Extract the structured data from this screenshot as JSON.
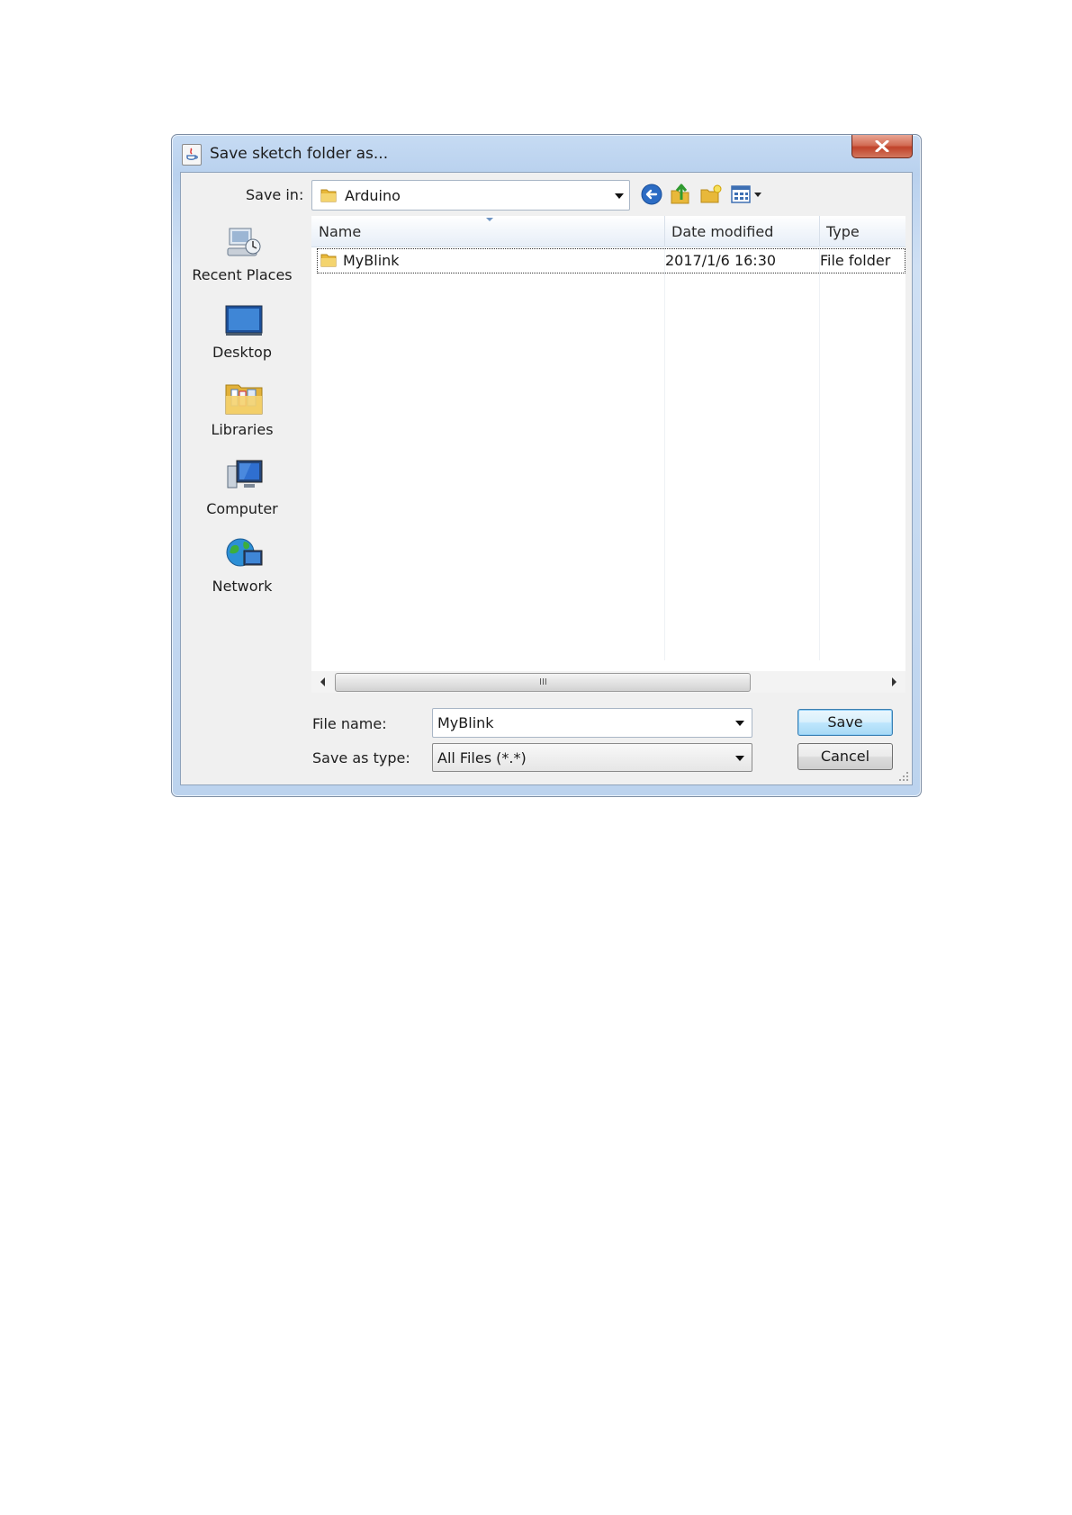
{
  "dialog": {
    "title": "Save sketch folder as...",
    "close_icon": "close-icon"
  },
  "toolbar": {
    "save_in_label": "Save in:",
    "save_in_value": "Arduino",
    "icons": [
      "back-icon",
      "up-folder-icon",
      "new-folder-icon",
      "view-menu-icon"
    ]
  },
  "places": [
    {
      "label": "Recent Places",
      "icon": "recent-places-icon"
    },
    {
      "label": "Desktop",
      "icon": "desktop-icon"
    },
    {
      "label": "Libraries",
      "icon": "libraries-icon"
    },
    {
      "label": "Computer",
      "icon": "computer-icon"
    },
    {
      "label": "Network",
      "icon": "network-icon"
    }
  ],
  "filelist": {
    "columns": [
      "Name",
      "Date modified",
      "Type"
    ],
    "rows": [
      {
        "name": "MyBlink",
        "date": "2017/1/6 16:30",
        "type": "File folder"
      }
    ]
  },
  "scrollbar": {
    "grip": "III"
  },
  "form": {
    "file_name_label": "File name:",
    "file_name_value": "MyBlink",
    "save_as_type_label": "Save as type:",
    "save_as_type_value": "All Files (*.*)"
  },
  "buttons": {
    "save": "Save",
    "cancel": "Cancel"
  },
  "colors": {
    "title_bar": "#c6dbf3",
    "close_button": "#c0432a",
    "default_button": "#3c7fb1",
    "folder_yellow": "#e8b83a"
  }
}
